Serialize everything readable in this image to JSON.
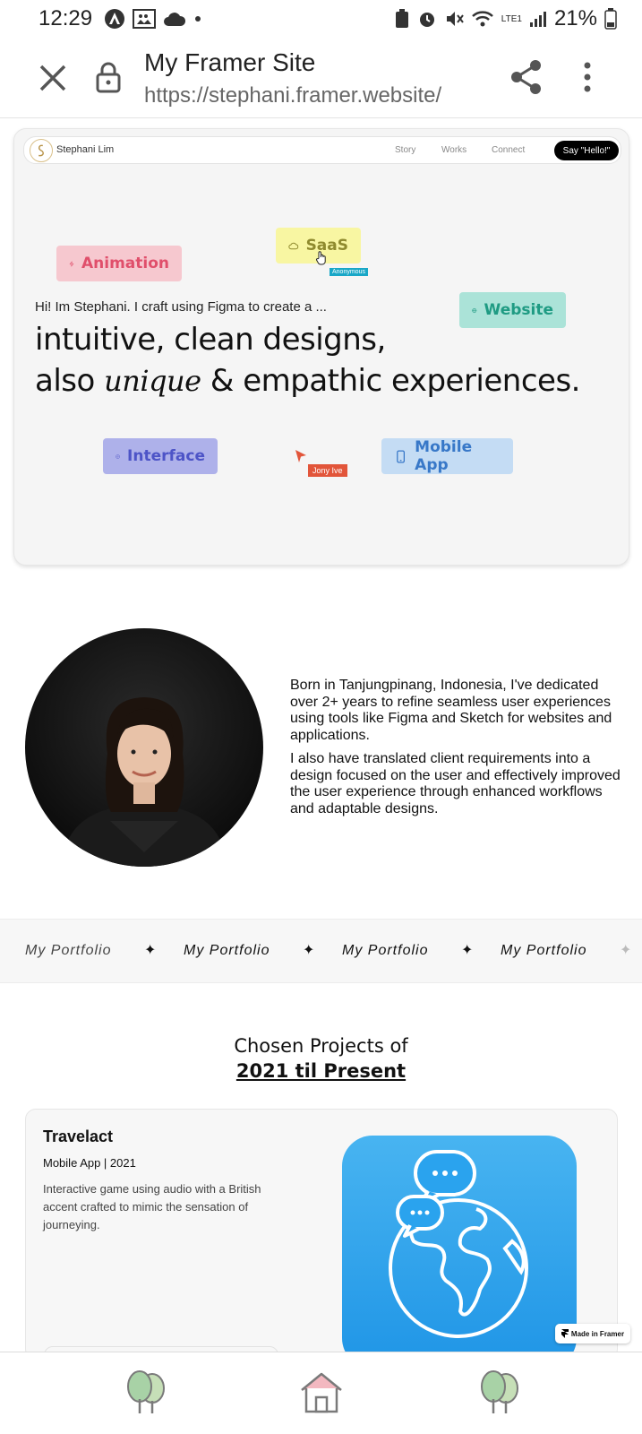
{
  "status_bar": {
    "time": "12:29",
    "battery": "21%",
    "network": "LTE1"
  },
  "browser": {
    "title": "My Framer Site",
    "url": "https://stephani.framer.website/"
  },
  "site_nav": {
    "brand": "Stephani Lim",
    "links": [
      "Story",
      "Works",
      "Connect"
    ],
    "cta": "Say \"Hello!\""
  },
  "hero": {
    "chips": {
      "animation": "Animation",
      "saas": "SaaS",
      "website": "Website",
      "interface": "Interface",
      "mobile_app": "Mobile App"
    },
    "cursor_labels": {
      "anonymous": "Anonymous",
      "jony": "Jony Ive"
    },
    "intro": "Hi! Im Stephani. I craft using Figma to create a ...",
    "headline_line1": "intuitive, clean designs,",
    "headline_also": "also",
    "headline_unique": "unique",
    "headline_rest": "& empathic experiences."
  },
  "about": {
    "p1": "Born in Tanjungpinang, Indonesia, I've dedicated over 2+ years to refine seamless user experiences using tools like Figma and Sketch for websites and applications.",
    "p2": "I also have translated client requirements into a design focused on the user and effectively improved the user experience through enhanced workflows and adaptable designs."
  },
  "marquee": {
    "text": "My Portfolio",
    "separator": "✦"
  },
  "projects": {
    "heading": "Chosen Projects of",
    "heading_period": "2021 til Present",
    "items": [
      {
        "title": "Travelact",
        "meta": "Mobile App | 2021",
        "description": "Interactive game using audio with a British accent crafted to mimic the sensation of journeying."
      }
    ]
  },
  "badge": {
    "made_in_framer": "Made in Framer"
  },
  "colors": {
    "animation_chip": "#f6c8cf",
    "saas_chip": "#f8f6a2",
    "website_chip": "#abe3d8",
    "interface_chip": "#aeb1ea",
    "mobile_chip": "#c4dcf4",
    "app_icon": "#2aa3ee"
  },
  "icons": [
    "close-icon",
    "lock-icon",
    "share-icon",
    "more-icon",
    "bolt-icon",
    "cloud-icon",
    "globe-icon",
    "interface-icon",
    "phone-icon",
    "tree-icon",
    "home-icon"
  ]
}
